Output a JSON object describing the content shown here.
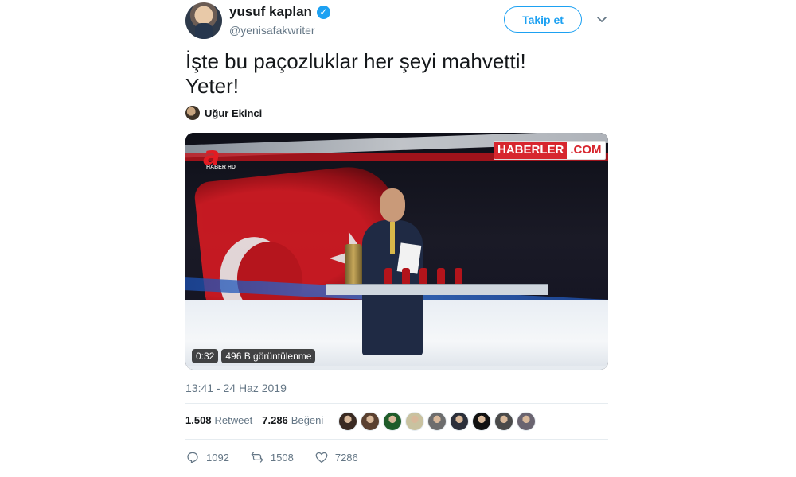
{
  "author": {
    "display_name": "yusuf kaplan",
    "handle": "@yenisafakwriter",
    "verified_icon": "verified-badge-icon"
  },
  "follow_button": {
    "label": "Takip et"
  },
  "tweet": {
    "lines": [
      "İşte bu paçozluklar her şeyi mahvetti!",
      "Yeter!"
    ]
  },
  "tagged_user": {
    "name": "Uğur Ekinci"
  },
  "media": {
    "duration": "0:32",
    "views": "496 B görüntülenme",
    "channel_logo": {
      "main": "a",
      "sub": "HABER HD"
    },
    "watermark": {
      "red_part": "HABERLER",
      "white_part": ".COM"
    },
    "progress_fraction": 0.0
  },
  "timestamp": "13:41 - 24 Haz 2019",
  "stats": {
    "retweet_count": "1.508",
    "retweet_label": "Retweet",
    "like_count": "7.286",
    "like_label": "Beğeni"
  },
  "likers": [
    {
      "color": "#3a2a22"
    },
    {
      "color": "#5a4030"
    },
    {
      "color": "#1f5c2a"
    },
    {
      "color": "#c9c2a0"
    },
    {
      "color": "#6d6d6d"
    },
    {
      "color": "#2b2f3a"
    },
    {
      "color": "#111111"
    },
    {
      "color": "#4a4a4a"
    },
    {
      "color": "#6a6470"
    }
  ],
  "actions": {
    "reply_count": "1092",
    "retweet_count": "1508",
    "like_count": "7286"
  },
  "colors": {
    "accent": "#1da1f2",
    "muted": "#657786",
    "text": "#14171a"
  }
}
